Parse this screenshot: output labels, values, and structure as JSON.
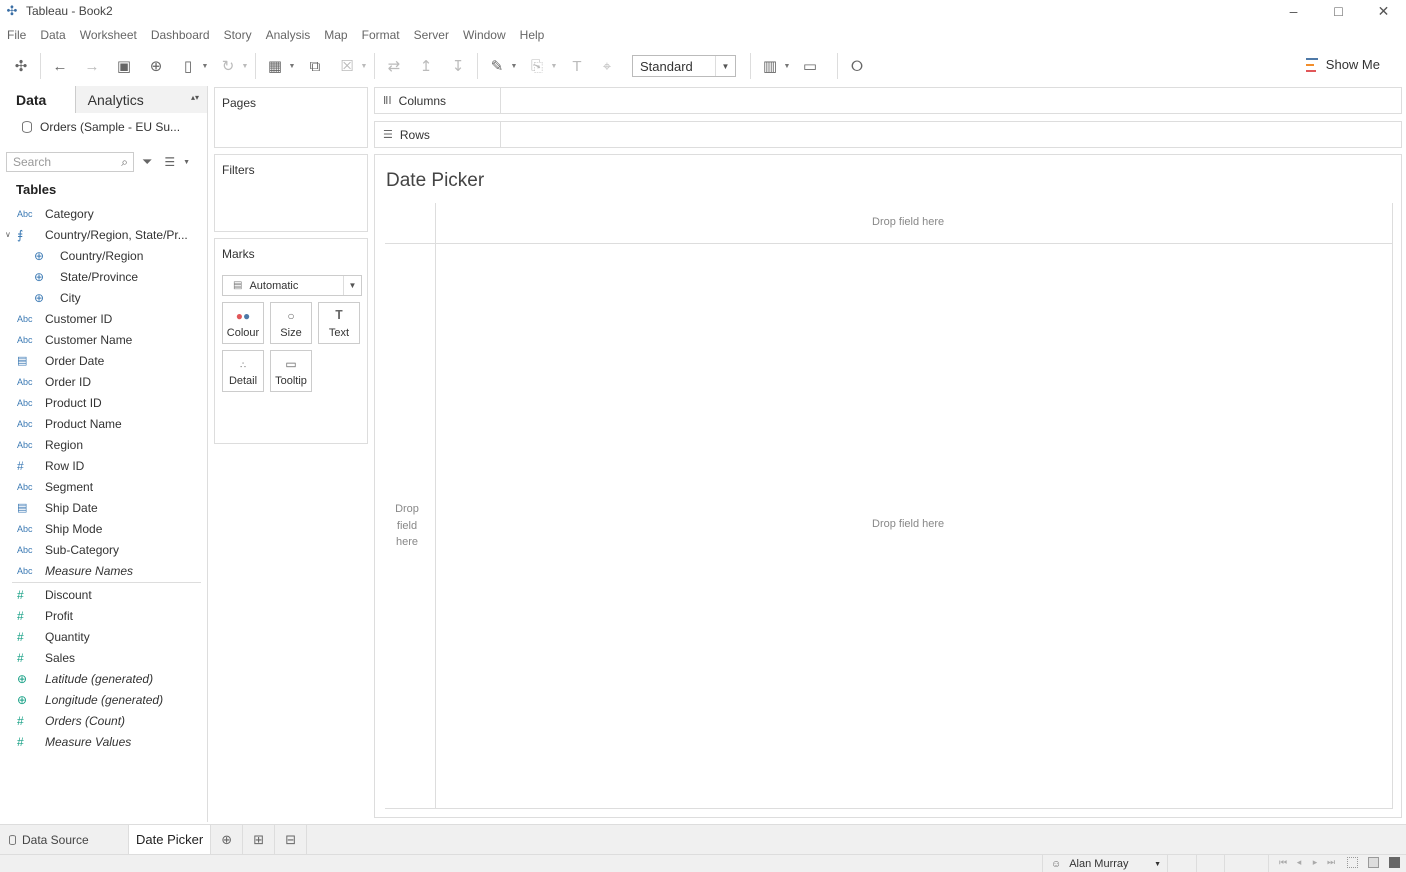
{
  "window": {
    "title": "Tableau - Book2",
    "controls": [
      "minimize",
      "maximize",
      "close"
    ]
  },
  "menu": [
    "File",
    "Data",
    "Worksheet",
    "Dashboard",
    "Story",
    "Analysis",
    "Map",
    "Format",
    "Server",
    "Window",
    "Help"
  ],
  "toolbar": {
    "fit_select": "Standard",
    "show_me_label": "Show Me"
  },
  "data_pane": {
    "tab_data": "Data",
    "tab_analytics": "Analytics",
    "datasource": "Orders (Sample - EU Su...",
    "search_placeholder": "Search",
    "tables_heading": "Tables",
    "fields": [
      {
        "type": "Abc",
        "name": "Category"
      },
      {
        "type": "hierarchy",
        "name": "Country/Region, State/Pr..."
      },
      {
        "type": "geo",
        "name": "Country/Region"
      },
      {
        "type": "geo",
        "name": "State/Province"
      },
      {
        "type": "geo",
        "name": "City"
      },
      {
        "type": "Abc",
        "name": "Customer ID"
      },
      {
        "type": "Abc",
        "name": "Customer Name"
      },
      {
        "type": "date",
        "name": "Order Date"
      },
      {
        "type": "Abc",
        "name": "Order ID"
      },
      {
        "type": "Abc",
        "name": "Product ID"
      },
      {
        "type": "Abc",
        "name": "Product Name"
      },
      {
        "type": "Abc",
        "name": "Region"
      },
      {
        "type": "#",
        "name": "Row ID"
      },
      {
        "type": "Abc",
        "name": "Segment"
      },
      {
        "type": "date",
        "name": "Ship Date"
      },
      {
        "type": "Abc",
        "name": "Ship Mode"
      },
      {
        "type": "Abc",
        "name": "Sub-Category"
      },
      {
        "type": "Abc",
        "name": "Measure Names"
      }
    ],
    "measures": [
      {
        "type": "#",
        "name": "Discount"
      },
      {
        "type": "#",
        "name": "Profit"
      },
      {
        "type": "#",
        "name": "Quantity"
      },
      {
        "type": "#",
        "name": "Sales"
      },
      {
        "type": "geo",
        "name": "Latitude (generated)"
      },
      {
        "type": "geo",
        "name": "Longitude (generated)"
      },
      {
        "type": "#",
        "name": "Orders (Count)"
      },
      {
        "type": "#",
        "name": "Measure Values"
      }
    ]
  },
  "cards": {
    "pages": "Pages",
    "filters": "Filters",
    "marks": "Marks",
    "mark_type": "Automatic",
    "buttons": {
      "colour": "Colour",
      "size": "Size",
      "text": "Text",
      "detail": "Detail",
      "tooltip": "Tooltip"
    }
  },
  "shelves": {
    "columns": "Columns",
    "rows": "Rows"
  },
  "canvas": {
    "sheet_title": "Date Picker",
    "drop_top": "Drop field here",
    "drop_middle": "Drop field here",
    "drop_left_1": "Drop",
    "drop_left_2": "field",
    "drop_left_3": "here"
  },
  "tabs": {
    "data_source": "Data Source",
    "sheet": "Date Picker"
  },
  "status": {
    "user": "Alan Murray"
  },
  "colors": {
    "dimension": "#3c7ab4",
    "measure": "#16a085",
    "showme_bars": [
      "#4e79a7",
      "#f28e2b",
      "#e15759"
    ]
  }
}
